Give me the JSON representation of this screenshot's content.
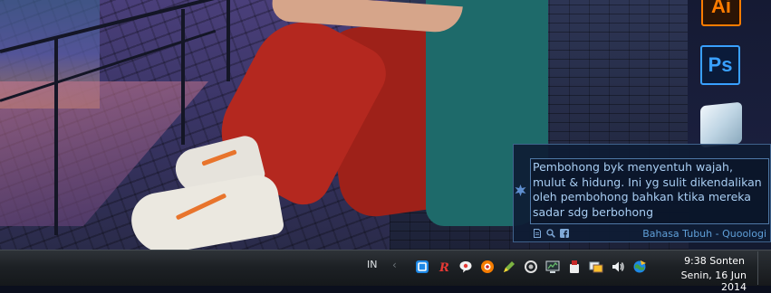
{
  "desktop": {
    "dock_apps": [
      {
        "icon": "illustrator-icon",
        "label": "Ai",
        "color": "#ff7c00"
      },
      {
        "icon": "photoshop-icon",
        "label": "Ps",
        "color": "#39a0ff"
      },
      {
        "icon": "cube-app-icon"
      }
    ]
  },
  "quote_widget": {
    "text": "Pembohong byk menyentuh wajah, mulut & hidung. Ini yg sulit dikendalikan oleh pembohong bahkan ktika mereka sadar sdg berbohong",
    "source": "Bahasa Tubuh - Quoologi",
    "text_color": "#a8cdf2",
    "source_color": "#5f9fd8",
    "tools": [
      "document-icon",
      "search-icon",
      "facebook-icon"
    ]
  },
  "taskbar": {
    "language": "IN",
    "tray_icons": [
      "maxthon-icon",
      "rss-icon",
      "chat-bubble-icon",
      "orange-app-icon",
      "pencil-check-icon",
      "sync-icon",
      "monitor-icon",
      "usb-icon",
      "network-icon",
      "volume-icon",
      "globe-icon"
    ],
    "clock": {
      "time": "9:38 Sonten",
      "date": "Senin, 16 Jun 2014"
    }
  }
}
